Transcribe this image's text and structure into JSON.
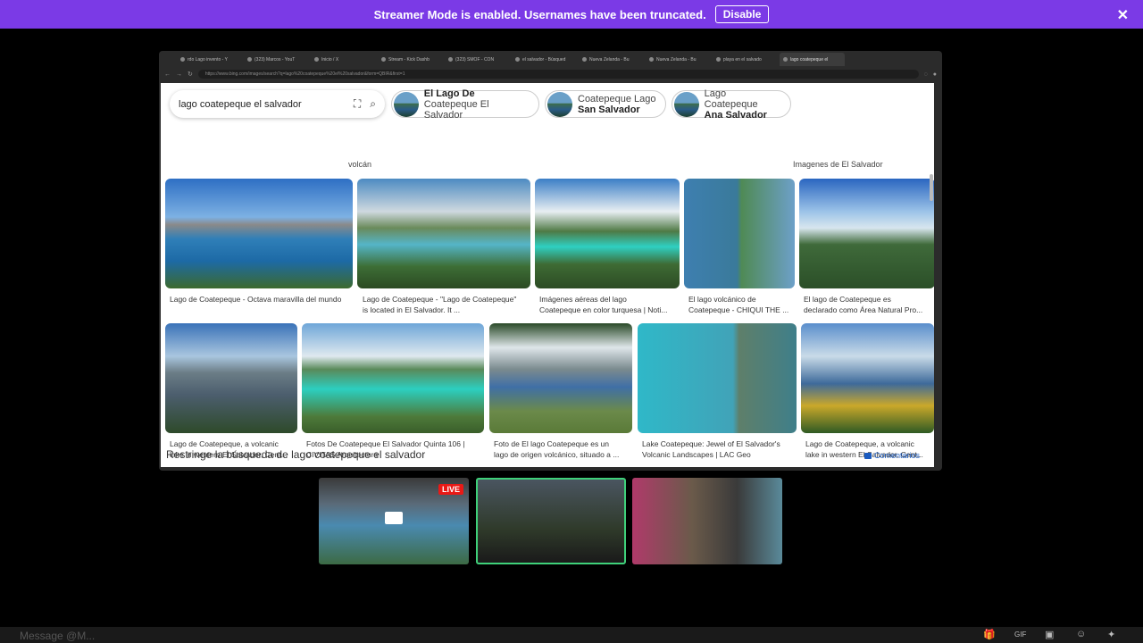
{
  "banner": {
    "text": "Streamer Mode is enabled. Usernames have been truncated.",
    "button": "Disable",
    "close": "✕"
  },
  "browser": {
    "tabs": [
      "rdo Lago invento - Y",
      "(323) Marcos - YouT",
      "Inicio / X",
      "Stream - Kick Dashb",
      "(323) SMOF - CON",
      "el salvador - Búsqued",
      "Nueva Zelanda - Bu",
      "Nueva Zelanda - Bu",
      "playa en el salvado",
      "lago coatepeque el"
    ],
    "url": "https://www.bing.com/images/search?q=lago%20coatepeque%20el%20salvador&form=QBIR&first=1"
  },
  "search": {
    "query": "lago coatepeque el salvador"
  },
  "chips": [
    {
      "line1": "El Lago De",
      "line2": "Coatepeque El Salvador"
    },
    {
      "line1": "Coatepeque Lago",
      "line2": "San Salvador"
    },
    {
      "line1": "Lago Coatepeque",
      "line2": "Ana Salvador"
    }
  ],
  "cut_labels": [
    "volcán",
    "Imagenes de El Salvador"
  ],
  "row1_captions": [
    [
      "Lago de Coatepeque - Octava maravilla del mundo",
      ""
    ],
    [
      "Lago de Coatepeque - \"Lago de Coatepeque\"",
      "is located in El Salvador. It ..."
    ],
    [
      "Imágenes aéreas del lago",
      "Coatepeque en color turquesa | Noti..."
    ],
    [
      "El lago volcánico de",
      "Coatepeque - CHIQUI THE ..."
    ],
    [
      "El lago de Coatepeque es",
      "declarado como Área Natural Pro..."
    ]
  ],
  "row2_captions": [
    [
      "Lago de Coatepeque, a volcanic",
      "lake in western El Salvador, Cent..."
    ],
    [
      "Fotos De Coatepeque El Salvador Quinta 106 |",
      "CIVITAS Arquitectura"
    ],
    [
      "Foto de El lago Coatepeque es un",
      "lago de origen volcánico, situado a ..."
    ],
    [
      "Lake Coatepeque: Jewel of El Salvador's",
      "Volcanic Landscapes | LAC Geo"
    ],
    [
      "Lago de Coatepeque, a volcanic",
      "lake in western El Salvador, Cent..."
    ]
  ],
  "refine": "Restringe la búsqueda de lago coatepeque el salvador",
  "feedback": "Comentarios",
  "live": "LIVE",
  "chat": {
    "placeholder": "Message @M..."
  }
}
